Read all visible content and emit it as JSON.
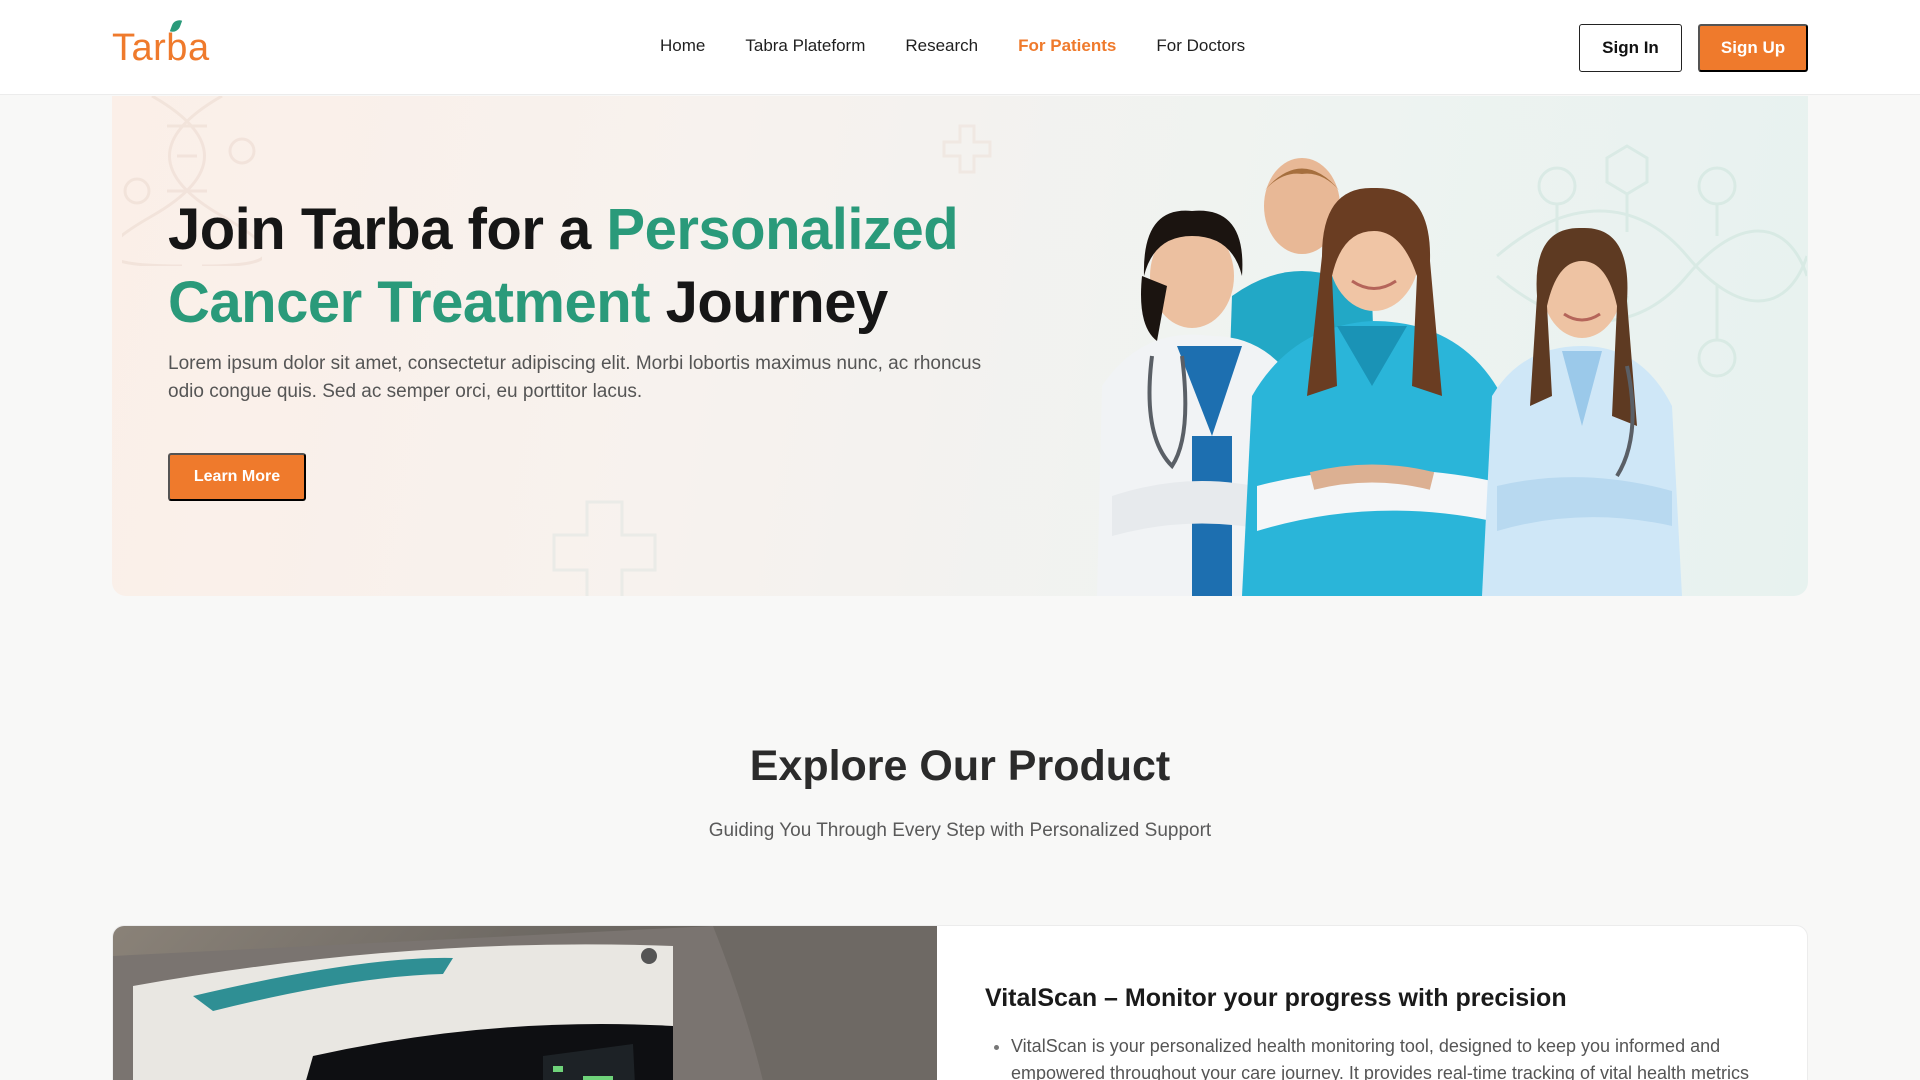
{
  "brand": {
    "name": "Tarba",
    "accent_color": "#ef7a2c",
    "secondary_color": "#2a9a7a"
  },
  "nav": {
    "items": [
      {
        "label": "Home",
        "active": false
      },
      {
        "label": "Tabra Plateform",
        "active": false
      },
      {
        "label": "Research",
        "active": false
      },
      {
        "label": "For Patients",
        "active": true
      },
      {
        "label": "For Doctors",
        "active": false
      }
    ]
  },
  "auth": {
    "sign_in_label": "Sign In",
    "sign_up_label": "Sign Up"
  },
  "hero": {
    "title_part1": "Join Tarba for a ",
    "title_accent": "Personalized Cancer Treatment",
    "title_part2": " Journey",
    "description": "Lorem ipsum dolor sit amet, consectetur adipiscing elit. Morbi lobortis maximus nunc, ac rhoncus odio congue quis. Sed ac semper orci, eu porttitor lacus.",
    "cta_label": "Learn More"
  },
  "explore": {
    "title": "Explore Our Product",
    "subtitle": "Guiding You Through Every Step with Personalized Support"
  },
  "product": {
    "title": "VitalScan – Monitor your progress with precision",
    "bullets": [
      "VitalScan is your personalized health monitoring tool, designed to keep you informed and empowered throughout your care journey. It provides real-time tracking of vital health metrics"
    ]
  }
}
